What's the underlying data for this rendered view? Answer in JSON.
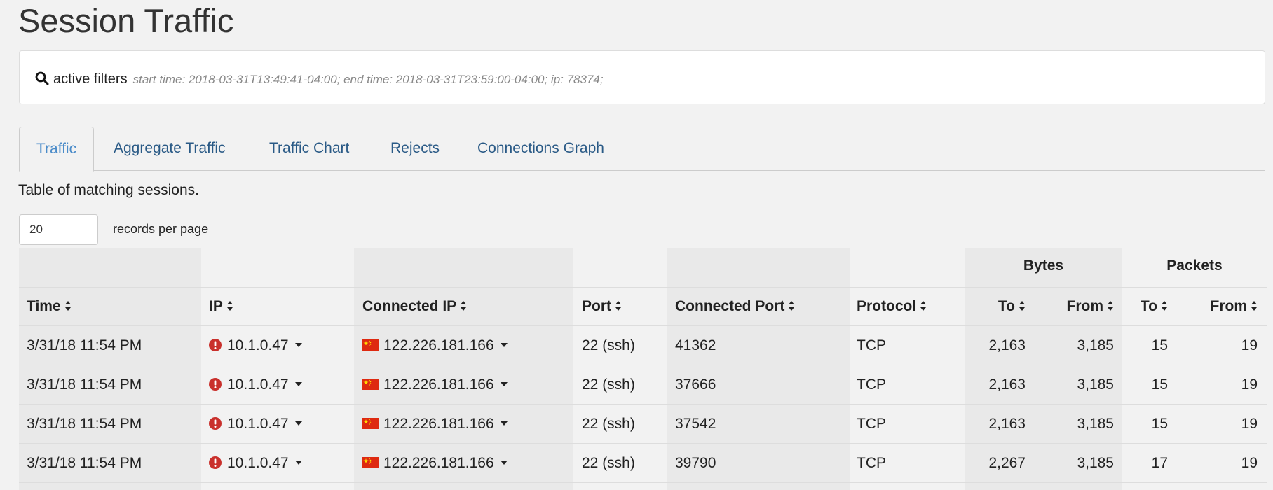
{
  "page": {
    "title": "Session Traffic"
  },
  "filters": {
    "label": "active filters",
    "text": "start time: 2018-03-31T13:49:41-04:00; end time: 2018-03-31T23:59:00-04:00; ip: 78374;",
    "icon": "search-icon"
  },
  "tabs": [
    {
      "label": "Traffic",
      "active": true
    },
    {
      "label": "Aggregate Traffic",
      "active": false
    },
    {
      "label": "Traffic Chart",
      "active": false
    },
    {
      "label": "Rejects",
      "active": false
    },
    {
      "label": "Connections Graph",
      "active": false
    }
  ],
  "table": {
    "caption": "Table of matching sessions.",
    "records_per_page": {
      "value": "20",
      "label": "records per page"
    },
    "groups": {
      "bytes": "Bytes",
      "packets": "Packets"
    },
    "columns": {
      "time": "Time",
      "ip": "IP",
      "connected_ip": "Connected IP",
      "port": "Port",
      "connected_port": "Connected Port",
      "protocol": "Protocol",
      "bytes_to": "To",
      "bytes_from": "From",
      "packets_to": "To",
      "packets_from": "From"
    },
    "rows": [
      {
        "time": "3/31/18 11:54 PM",
        "ip": "10.1.0.47",
        "connected_ip": "122.226.181.166",
        "port": "22 (ssh)",
        "connected_port": "41362",
        "protocol": "TCP",
        "bytes_to": "2,163",
        "bytes_from": "3,185",
        "packets_to": "15",
        "packets_from": "19"
      },
      {
        "time": "3/31/18 11:54 PM",
        "ip": "10.1.0.47",
        "connected_ip": "122.226.181.166",
        "port": "22 (ssh)",
        "connected_port": "37666",
        "protocol": "TCP",
        "bytes_to": "2,163",
        "bytes_from": "3,185",
        "packets_to": "15",
        "packets_from": "19"
      },
      {
        "time": "3/31/18 11:54 PM",
        "ip": "10.1.0.47",
        "connected_ip": "122.226.181.166",
        "port": "22 (ssh)",
        "connected_port": "37542",
        "protocol": "TCP",
        "bytes_to": "2,163",
        "bytes_from": "3,185",
        "packets_to": "15",
        "packets_from": "19"
      },
      {
        "time": "3/31/18 11:54 PM",
        "ip": "10.1.0.47",
        "connected_ip": "122.226.181.166",
        "port": "22 (ssh)",
        "connected_port": "39790",
        "protocol": "TCP",
        "bytes_to": "2,267",
        "bytes_from": "3,185",
        "packets_to": "17",
        "packets_from": "19"
      }
    ]
  },
  "colors": {
    "alert": "#c9302c",
    "link": "#2a5a86",
    "active_tab": "#4a8bc9",
    "flag_red": "#de2910",
    "flag_star": "#ffde00"
  }
}
